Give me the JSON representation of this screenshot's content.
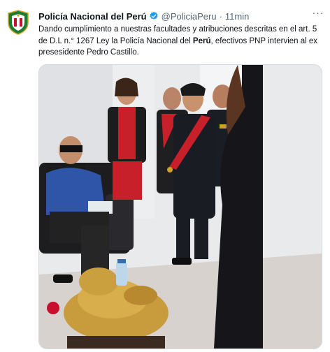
{
  "tweet": {
    "author_name": "Policía Nacional del Perú",
    "handle": "@PoliciaPeru",
    "separator": "·",
    "time": "11min",
    "more_label": "···",
    "text_part1": "Dando cumplimiento a nuestras facultades y atribuciones descritas en el art. 5 de D.L n.° 1267 Ley la Policía Nacional del ",
    "text_bold": "Perú",
    "text_part2": ", efectivos PNP intervien al ex presesidente Pedro Castillo."
  },
  "colors": {
    "verified": "#1d9bf0",
    "secondary_text": "#536471",
    "border": "#cfd9de",
    "badge_red": "#c8102e",
    "badge_green": "#1e7b34"
  },
  "icons": {
    "avatar": "police-badge-icon",
    "verified": "verified-check-icon",
    "more": "more-dots-icon"
  }
}
